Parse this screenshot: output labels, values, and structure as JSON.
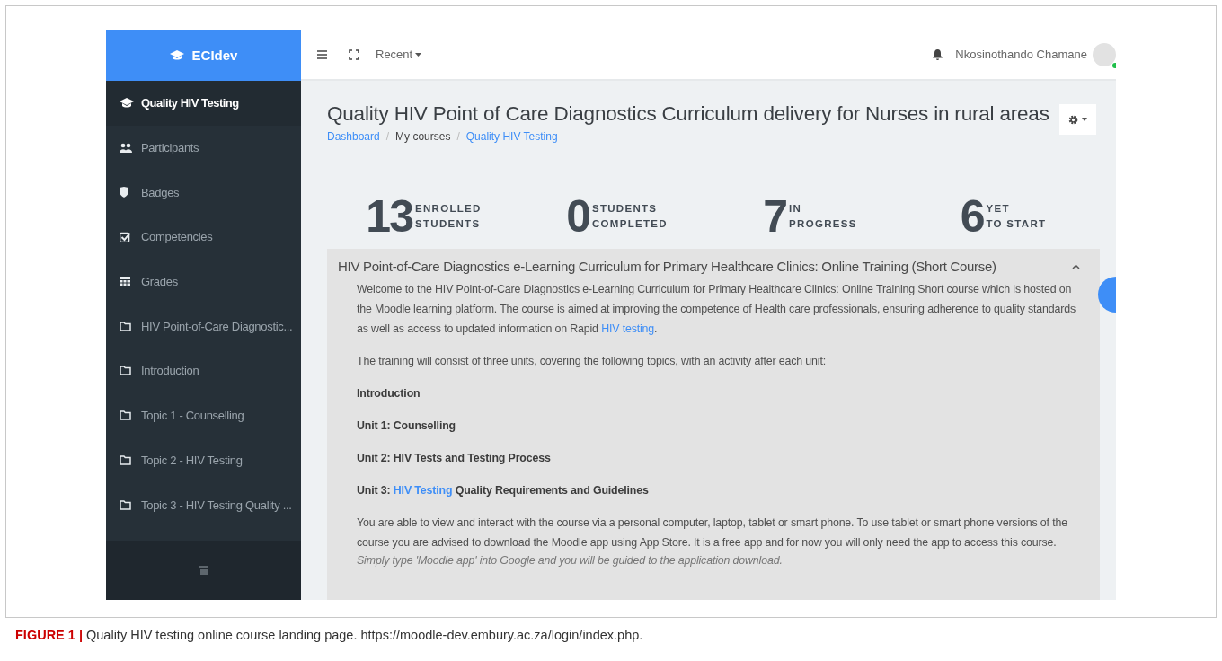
{
  "topbar": {
    "brand": "ECIdev",
    "recent": "Recent",
    "user_name": "Nkosinothando Chamane",
    "user_online": true
  },
  "sidebar": {
    "items": [
      {
        "label": "Quality HIV Testing",
        "kind": "course",
        "selected": true
      },
      {
        "label": "Participants",
        "kind": "participants",
        "selected": false
      },
      {
        "label": "Badges",
        "kind": "badges",
        "selected": false
      },
      {
        "label": "Competencies",
        "kind": "competencies",
        "selected": false
      },
      {
        "label": "Grades",
        "kind": "grades",
        "selected": false
      },
      {
        "label": "HIV Point-of-Care Diagnostic...",
        "kind": "section",
        "selected": false
      },
      {
        "label": "Introduction",
        "kind": "section",
        "selected": false
      },
      {
        "label": "Topic 1 - Counselling",
        "kind": "section",
        "selected": false
      },
      {
        "label": "Topic 2 - HIV Testing",
        "kind": "section",
        "selected": false
      },
      {
        "label": "Topic 3 - HIV Testing Quality ...",
        "kind": "section",
        "selected": false
      }
    ]
  },
  "page": {
    "title": "Quality HIV Point of Care Diagnostics Curriculum delivery for Nurses in rural areas",
    "breadcrumb": [
      {
        "label": "Dashboard",
        "kind": "link"
      },
      {
        "label": "/",
        "kind": "separator"
      },
      {
        "label": "My courses",
        "kind": "text"
      },
      {
        "label": "/",
        "kind": "separator"
      },
      {
        "label": "Quality HIV Testing",
        "kind": "link"
      }
    ],
    "stats": [
      {
        "number": "13",
        "label": "ENROLLED\nSTUDENTS"
      },
      {
        "number": "0",
        "label": "STUDENTS\nCOMPLETED"
      },
      {
        "number": "7",
        "label": "IN\nPROGRESS"
      },
      {
        "number": "6",
        "label": "YET\nTO START"
      }
    ],
    "section": {
      "title": "HIV Point-of-Care Diagnostics e-Learning Curriculum for Primary Healthcare Clinics: Online Training (Short Course)",
      "expanded": true,
      "paragraphs": [
        {
          "kind": "text",
          "segments": [
            {
              "text": "Welcome to the HIV Point-of-Care Diagnostics e-Learning Curriculum for Primary Healthcare Clinics: Online Training Short course which is hosted on the Moodle learning platform. The course is aimed at improving the competence of Health care professionals, ensuring adherence to quality standards as well as access to updated information on Rapid ",
              "kind": "text"
            },
            {
              "text": "HIV testing",
              "kind": "link"
            },
            {
              "text": ".",
              "kind": "text"
            }
          ]
        },
        {
          "kind": "text",
          "segments": [
            {
              "text": "The training will consist of three units, covering the following topics, with an activity after each unit:",
              "kind": "text"
            }
          ]
        },
        {
          "kind": "bold",
          "segments": [
            {
              "text": "Introduction",
              "kind": "text"
            }
          ]
        },
        {
          "kind": "bold",
          "segments": [
            {
              "text": "Unit 1: Counselling",
              "kind": "text"
            }
          ]
        },
        {
          "kind": "bold",
          "segments": [
            {
              "text": "Unit 2: HIV Tests and Testing Process",
              "kind": "text"
            }
          ]
        },
        {
          "kind": "bold",
          "segments": [
            {
              "text": "Unit 3: ",
              "kind": "text"
            },
            {
              "text": "HIV Testing",
              "kind": "link"
            },
            {
              "text": " Quality Requirements and Guidelines",
              "kind": "text"
            }
          ]
        },
        {
          "kind": "text",
          "segments": [
            {
              "text": "You are able to view and interact with the course via a personal computer, laptop, tablet or smart phone. To use tablet or smart phone versions of the course you are advised to download the Moodle app using App Store. It is a free app and for now you will only need the app to access this course.",
              "kind": "text"
            }
          ]
        },
        {
          "kind": "note",
          "segments": [
            {
              "text": "Simply type 'Moodle app' into Google and you will be guided to the application download.",
              "kind": "text"
            }
          ]
        }
      ]
    }
  },
  "caption": "**FIGURE 1 |** Quality HIV testing online course landing page. https://moodle-dev.embury.ac.za/login/index.php."
}
